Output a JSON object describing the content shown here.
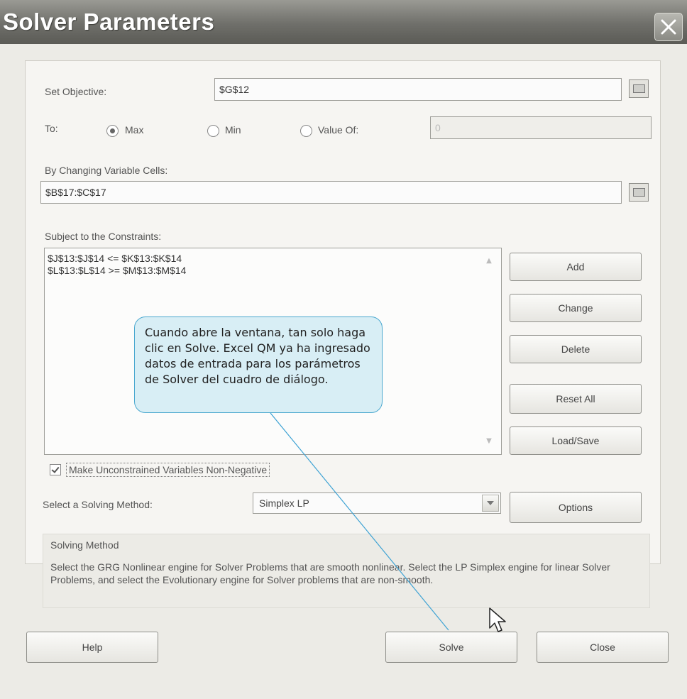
{
  "window": {
    "title": "Solver Parameters"
  },
  "objective": {
    "label": "Set Objective:",
    "value": "$G$12"
  },
  "to": {
    "label": "To:",
    "options": [
      {
        "label": "Max",
        "selected": true
      },
      {
        "label": "Min",
        "selected": false
      },
      {
        "label": "Value Of:",
        "selected": false
      }
    ],
    "value_of": "0"
  },
  "variables": {
    "label": "By Changing Variable Cells:",
    "value": "$B$17:$C$17"
  },
  "constraints": {
    "label": "Subject to the Constraints:",
    "items": [
      "$J$13:$J$14 <= $K$13:$K$14",
      "$L$13:$L$14 >= $M$13:$M$14"
    ]
  },
  "buttons": {
    "add": "Add",
    "change": "Change",
    "delete": "Delete",
    "reset_all": "Reset All",
    "load_save": "Load/Save",
    "options": "Options",
    "help": "Help",
    "solve": "Solve",
    "close": "Close"
  },
  "nonnegative": {
    "label": "Make Unconstrained Variables Non-Negative",
    "checked": true
  },
  "solving_method": {
    "label": "Select a Solving Method:",
    "value": "Simplex LP"
  },
  "method_info": {
    "title": "Solving Method",
    "description": "Select the GRG Nonlinear engine for Solver Problems that are smooth nonlinear. Select the LP Simplex engine for linear Solver Problems, and select the Evolutionary engine for Solver problems that are non-smooth."
  },
  "callout": {
    "text": "Cuando abre la ventana, tan solo haga clic en Solve. Excel QM ya ha ingresado datos de entrada para los parámetros de Solver del cuadro de diálogo."
  },
  "colors": {
    "callout_fill": "#d8eef5",
    "callout_border": "#4aa8cf",
    "titlebar": "#6f6f6a"
  }
}
